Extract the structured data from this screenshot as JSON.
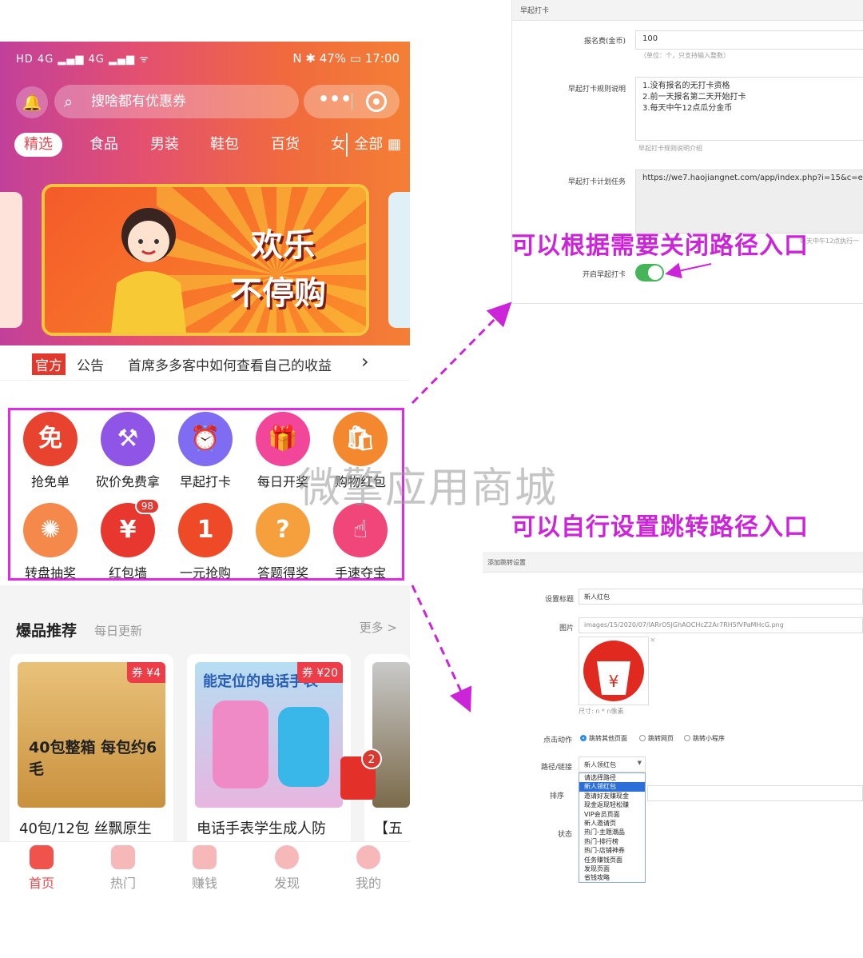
{
  "phone": {
    "status_left": "HD 4G ▂▄▆ 4G ▂▄▆ ᯤ",
    "status_right": "N ✱ 47% ▭ 17:00",
    "search_placeholder": "搜啥都有优惠券",
    "categories": [
      "精选",
      "食品",
      "男装",
      "鞋包",
      "百货",
      "女"
    ],
    "categories_all": "全部",
    "banner_line1": "欢乐",
    "banner_line2": "不停购",
    "notice_tag1": "官方",
    "notice_tag2": "公告",
    "notice_text": "首席多多客中如何查看自己的收益",
    "grid_items": [
      {
        "label": "抢免单",
        "glyph": "免",
        "color": "#e8432f"
      },
      {
        "label": "砍价免费拿",
        "glyph": "⚒",
        "color": "#8f55e6"
      },
      {
        "label": "早起打卡",
        "glyph": "⏰",
        "color": "#7f6cf2"
      },
      {
        "label": "每日开奖",
        "glyph": "🎁",
        "color": "#f2469a"
      },
      {
        "label": "购物红包",
        "glyph": "🛍",
        "color": "#f4882e"
      },
      {
        "label": "转盘抽奖",
        "glyph": "✺",
        "color": "#f5884b"
      },
      {
        "label": "红包墙",
        "glyph": "¥",
        "color": "#e8372f",
        "badge": "98"
      },
      {
        "label": "一元抢购",
        "glyph": "1",
        "color": "#ee4a28"
      },
      {
        "label": "答题得奖",
        "glyph": "?",
        "color": "#f5a03c"
      },
      {
        "label": "手速夺宝",
        "glyph": "☝",
        "color": "#f0467a"
      }
    ],
    "hot_title": "爆品推荐",
    "hot_sub": "每日更新",
    "hot_more": "更多 >",
    "products": [
      {
        "name": "40包/12包 丝飘原生",
        "tag": "券 ¥4",
        "img_text": "40包整箱 每包约6毛"
      },
      {
        "name": "电话手表学生成人防",
        "tag": "券 ¥20",
        "img_text": "能定位的电话手表"
      },
      {
        "name": "【五",
        "tag": "",
        "img_text": ""
      }
    ],
    "float_badge": "2",
    "tabs": [
      "首页",
      "热门",
      "赚钱",
      "发现",
      "我的"
    ]
  },
  "panel1": {
    "title": "早起打卡",
    "fee_label": "报名费(金币)",
    "fee_value": "100",
    "fee_hint": "（单位：个，只支持输入整数）",
    "rules_label": "早起打卡规则说明",
    "rules_lines": [
      "1.没有报名的无打卡资格",
      "2.前一天报名第二天开始打卡",
      "3.每天中午12点瓜分金币"
    ],
    "rules_hint": "早起打卡规则说明介绍",
    "task_label": "早起打卡计划任务",
    "task_value": "https://we7.haojiangnet.com/app/index.php?i=15&c=entr",
    "task_hint": "每天中午12点执行一",
    "switch_label": "开启早起打卡"
  },
  "panel2": {
    "title": "添加跳转设置",
    "title_label": "设置标题",
    "title_value": "新人红包",
    "image_label": "图片",
    "image_value": "images/15/2020/07/lARrO5JGhAOCHcZ2Ar7RH5fVPaMHcG.png",
    "image_size": "尺寸: n * n像素",
    "action_label": "点击动作",
    "radios": [
      "跳转其他页面",
      "跳转网页",
      "跳转小程序"
    ],
    "path_label": "路径/链接",
    "path_value": "新人领红包",
    "sort_label": "排序",
    "status_label": "状态",
    "options": [
      "请选择路径",
      "新人领红包",
      "邀请好友赚现金",
      "现金返现轻松赚",
      "VIP会员页面",
      "新人邀请页",
      "热门-主题潮品",
      "热门-排行榜",
      "热门-店铺神券",
      "任务赚钱页面",
      "发现页面",
      "省钱攻略"
    ],
    "selected_option": 1
  },
  "notes": {
    "note1": "可以根据需要关闭路径入口",
    "note2": "可以自行设置跳转路径入口",
    "watermark": "微擎应用商城"
  },
  "colors": {
    "accent": "#cc24d8",
    "brand_red": "#ef4a4e",
    "switch_on": "#46b55a"
  }
}
